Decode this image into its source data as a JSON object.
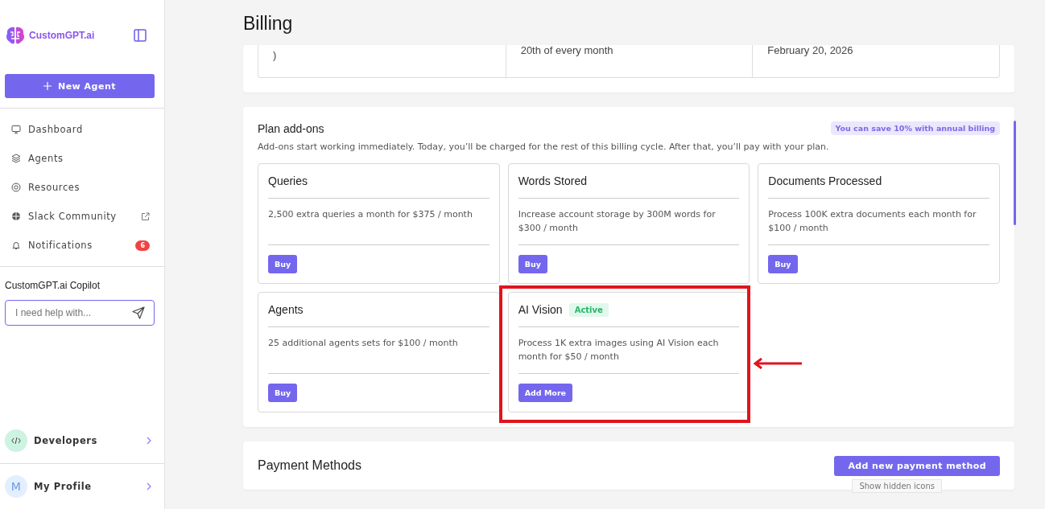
{
  "sidebar": {
    "brand": "CustomGPT.ai",
    "new_button": "New Agent",
    "nav": [
      {
        "kind": "monitor",
        "label": "Dashboard",
        "external": false
      },
      {
        "kind": "layers",
        "label": "Agents",
        "external": false
      },
      {
        "kind": "lifebuoy",
        "label": "Resources",
        "external": false
      },
      {
        "kind": "globe",
        "label": "Slack Community",
        "external": true
      },
      {
        "kind": "bell",
        "label": "Notifications",
        "badge": "6",
        "external": false
      }
    ],
    "copilot": {
      "title": "CustomGPT.ai Copilot",
      "placeholder": "I need help with..."
    },
    "developers": "Developers",
    "profile": {
      "initial": "M",
      "label": "My Profile"
    }
  },
  "page_title": "Billing",
  "billing_summary": [
    ")",
    "20th of every month",
    "February 20, 2026"
  ],
  "addons": {
    "title": "Plan add-ons",
    "promo": "You can save 10% with annual billing",
    "subtitle": "Add-ons start working immediately. Today, you’ll be charged for the rest of this billing cycle. After that, you’ll pay with your plan.",
    "items": [
      {
        "title": "Queries",
        "description": "2,500 extra queries a month for $375 / month",
        "button": "Buy",
        "highlighted": false
      },
      {
        "title": "Words Stored",
        "description": "Increase account storage by 300M words for $300 / month",
        "button": "Buy",
        "highlighted": false
      },
      {
        "title": "Documents Processed",
        "description": "Process 100K extra documents each month for $100 / month",
        "button": "Buy",
        "highlighted": false
      },
      {
        "title": "Agents",
        "description": "25 additional agents sets for $100 / month",
        "button": "Buy",
        "highlighted": false
      },
      {
        "title": "AI Vision",
        "badge": "Active",
        "description": "Process 1K extra images using AI Vision each month for $50 / month",
        "button": "Add More",
        "highlighted": true
      }
    ]
  },
  "payment_methods": {
    "title": "Payment Methods",
    "button": "Add new payment method"
  },
  "tooltip": "Show hidden icons"
}
